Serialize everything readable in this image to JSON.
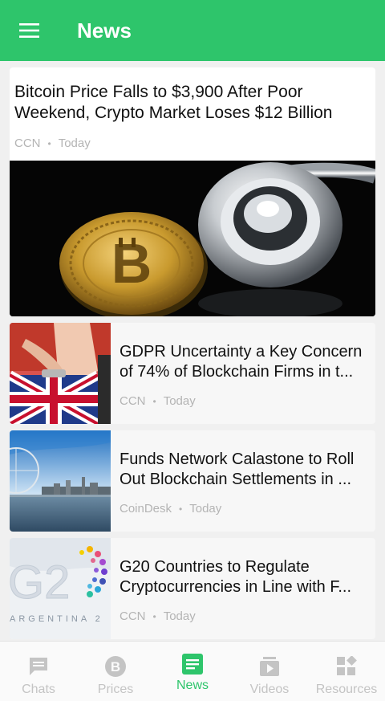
{
  "header": {
    "title": "News"
  },
  "featured": {
    "title_line1": "Bitcoin Price Falls to $3,900 After Poor",
    "title_line2": "Weekend, Crypto Market Loses $12 Billion",
    "source": "CCN",
    "time": "Today",
    "image_icon": "bitcoin-coin-and-stethoscope-photo"
  },
  "articles": [
    {
      "title_line1": "GDPR Uncertainty a Key Concern",
      "title_line2": "of 74% of Blockchain Firms in t...",
      "source": "CCN",
      "time": "Today",
      "thumb_icon": "union-jack-purse-photo"
    },
    {
      "title_line1": "Funds Network Calastone to Roll",
      "title_line2": "Out Blockchain Settlements in ...",
      "source": "CoinDesk",
      "time": "Today",
      "thumb_icon": "london-skyline-photo"
    },
    {
      "title_line1": "G20 Countries to Regulate",
      "title_line2": "Cryptocurrencies in Line with F...",
      "source": "CCN",
      "time": "Today",
      "thumb_icon": "g20-argentina-logo-photo",
      "thumb_text_logo": "G2",
      "thumb_text_country": "ARGENTINA 2"
    }
  ],
  "bottom_nav": {
    "items": [
      {
        "label": "Chats",
        "icon": "chat-icon",
        "active": false
      },
      {
        "label": "Prices",
        "icon": "bitcoin-icon",
        "active": false
      },
      {
        "label": "News",
        "icon": "news-icon",
        "active": true
      },
      {
        "label": "Videos",
        "icon": "video-icon",
        "active": false
      },
      {
        "label": "Resources",
        "icon": "resources-icon",
        "active": false
      }
    ]
  },
  "colors": {
    "accent": "#2ec56b",
    "meta_text": "#b4b4b4",
    "inactive_nav": "#c4c4c4"
  }
}
